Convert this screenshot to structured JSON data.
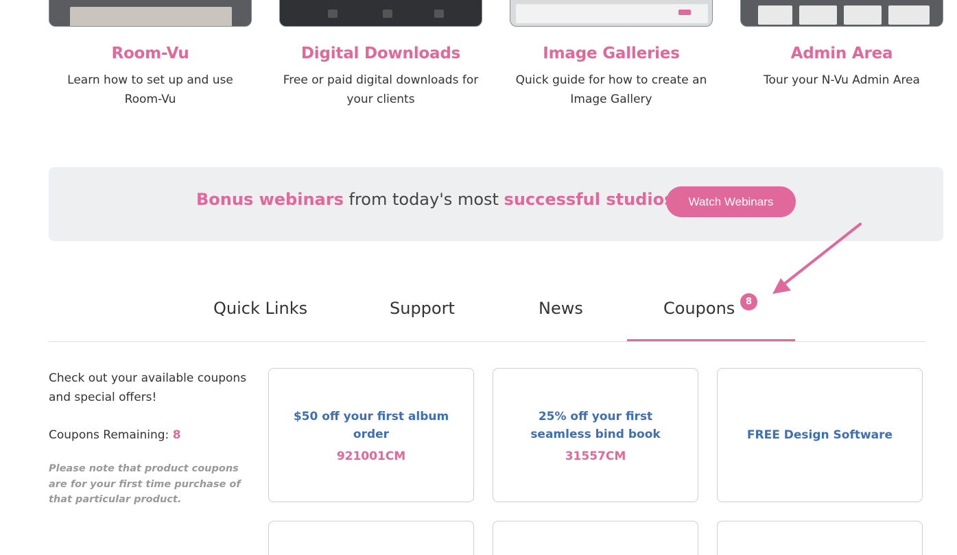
{
  "features": [
    {
      "title": "Room-Vu",
      "desc": "Learn how to set up and use Room-Vu"
    },
    {
      "title": "Digital Downloads",
      "desc": "Free or paid digital downloads for your clients"
    },
    {
      "title": "Image Galleries",
      "desc": "Quick guide for how to create an Image Gallery"
    },
    {
      "title": "Admin Area",
      "desc": "Tour your N-Vu Admin Area"
    }
  ],
  "banner": {
    "part1": "Bonus webinars",
    "part2": " from today's most ",
    "part3": "successful studios.",
    "button": "Watch Webinars"
  },
  "tabs": {
    "items": [
      "Quick Links",
      "Support",
      "News",
      "Coupons"
    ],
    "active": "Coupons",
    "coupons_badge": "8"
  },
  "coupons_panel": {
    "intro": "Check out your available coupons and special offers!",
    "remaining_label": "Coupons Remaining: ",
    "remaining_count": "8",
    "note": "Please note that product coupons are for your first time purchase of that particular product.",
    "cards": [
      {
        "title": "$50 off your first album order",
        "code": "921001CM"
      },
      {
        "title": "25% off your first seamless bind book",
        "code": "31557CM"
      },
      {
        "title": "FREE Design Software",
        "code": ""
      }
    ]
  },
  "colors": {
    "accent": "#e0689a",
    "link": "#3e6fb5",
    "banner_bg": "#eeeff1"
  }
}
